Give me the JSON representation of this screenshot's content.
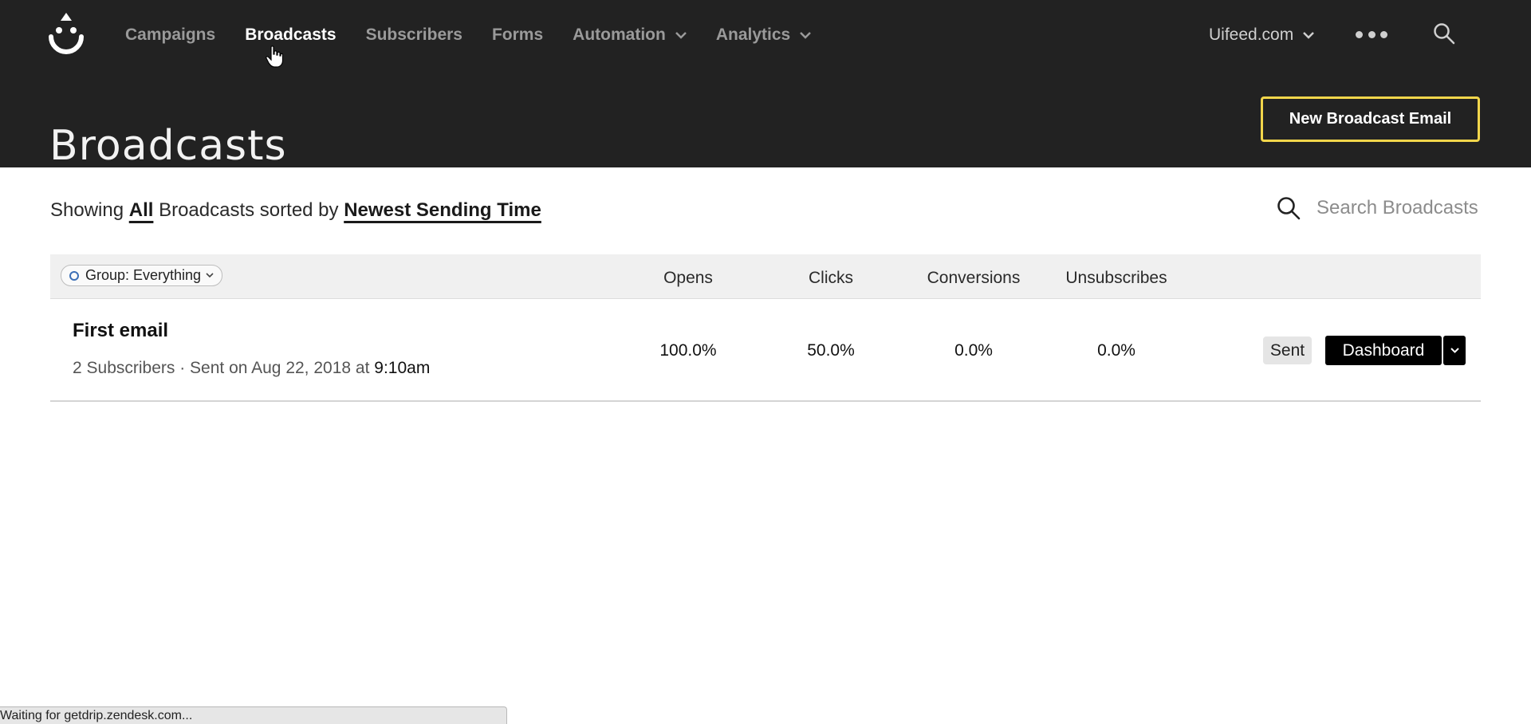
{
  "nav": {
    "items": [
      {
        "label": "Campaigns",
        "active": false,
        "dropdown": false
      },
      {
        "label": "Broadcasts",
        "active": true,
        "dropdown": false
      },
      {
        "label": "Subscribers",
        "active": false,
        "dropdown": false
      },
      {
        "label": "Forms",
        "active": false,
        "dropdown": false
      },
      {
        "label": "Automation",
        "active": false,
        "dropdown": true
      },
      {
        "label": "Analytics",
        "active": false,
        "dropdown": true
      }
    ],
    "account": "Uifeed.com"
  },
  "page": {
    "title": "Broadcasts",
    "new_button": "New Broadcast Email"
  },
  "filter": {
    "showing": "Showing",
    "scope": "All",
    "middle": "Broadcasts sorted by",
    "sort": "Newest Sending Time"
  },
  "search": {
    "placeholder": "Search Broadcasts"
  },
  "table": {
    "group_filter": "Group: Everything",
    "columns": [
      "Opens",
      "Clicks",
      "Conversions",
      "Unsubscribes"
    ],
    "rows": [
      {
        "title": "First email",
        "subtitle_prefix": "2 Subscribers · Sent on Aug 22, 2018 at",
        "time": "9:10am",
        "opens": "100.0%",
        "clicks": "50.0%",
        "conversions": "0.0%",
        "unsubscribes": "0.0%",
        "status": "Sent",
        "action": "Dashboard"
      }
    ]
  },
  "statusbar": "Waiting for getdrip.zendesk.com...",
  "colors": {
    "header_bg": "#222222",
    "accent_border": "#f2d64b",
    "nav_active": "#ffffff",
    "nav_inactive": "#9a9a9a"
  },
  "icons": [
    "drip-logo-icon",
    "chevron-down-icon",
    "more-dots-icon",
    "search-icon",
    "hand-pointer-icon"
  ]
}
